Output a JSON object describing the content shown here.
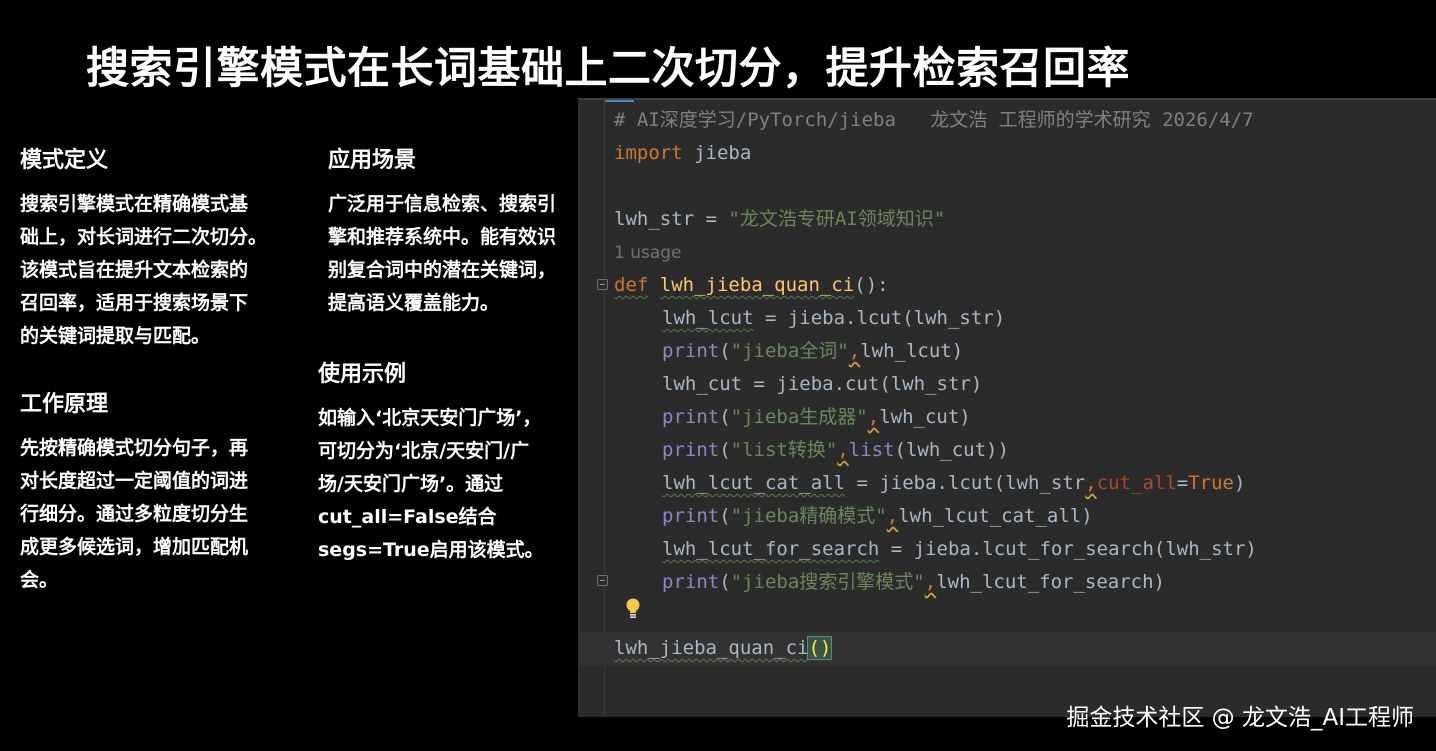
{
  "title": "搜索引擎模式在长词基础上二次切分，提升检索召回率",
  "sections": {
    "definition": {
      "heading": "模式定义",
      "body": "搜索引擎模式在精确模式基\n础上，对长词进行二次切分。\n该模式旨在提升文本检索的\n召回率，适用于搜索场景下\n的关键词提取与匹配。"
    },
    "principle": {
      "heading": "工作原理",
      "body": "先按精确模式切分句子，再\n对长度超过一定阈值的词进\n行细分。通过多粒度切分生\n成更多候选词，增加匹配机\n会。"
    },
    "application": {
      "heading": "应用场景",
      "body": "广泛用于信息检索、搜索引\n擎和推荐系统中。能有效识\n别复合词中的潜在关键词，\n提高语义覆盖能力。"
    },
    "example": {
      "heading": "使用示例",
      "body": "如输入‘北京天安门广场’，\n可切分为‘北京/天安门/广\n场/天安门广场’。通过\ncut_all=False结合\nsegs=True启用该模式。"
    }
  },
  "code": {
    "comment": "# AI深度学习/PyTorch/jieba   龙文浩 工程师的学术研究 2026/4/7",
    "import_kw": "import",
    "import_mod": " jieba",
    "assign_var": "lwh_str",
    "assign_op": " = ",
    "assign_str": "\"龙文浩专研AI领域知识\"",
    "usage_hint": "1 usage",
    "def_kw": "def",
    "def_name": "lwh_jieba_quan_ci",
    "def_tail": "():",
    "l1_var": "lwh_lcut",
    "l1_rest": " = jieba.lcut(lwh_str)",
    "p1_fn": "print",
    "p1_open": "(",
    "p1_str": "\"jieba全词\"",
    "p1_comma": ",",
    "p1_arg": "lwh_lcut)",
    "l2": "lwh_cut = jieba.cut(lwh_str)",
    "p2_fn": "print",
    "p2_open": "(",
    "p2_str": "\"jieba生成器\"",
    "p2_comma": ",",
    "p2_arg": "lwh_cut)",
    "p3_fn": "print",
    "p3_open": "(",
    "p3_str": "\"list转换\"",
    "p3_comma": ",",
    "p3_builtin": "list",
    "p3_arg": "(lwh_cut))",
    "l4_var": "lwh_lcut_cat_all",
    "l4_mid": " = jieba.lcut(lwh_str",
    "l4_comma": ",",
    "l4_param": "cut_all",
    "l4_eq": "=",
    "l4_true": "True",
    "l4_close": ")",
    "p4_fn": "print",
    "p4_open": "(",
    "p4_str": "\"jieba精确模式\"",
    "p4_comma": ",",
    "p4_arg": "lwh_lcut_cat_all)",
    "l5_var": "lwh_lcut_for_search",
    "l5_rest": " = jieba.lcut_for_search(lwh_str)",
    "p5_fn": "print",
    "p5_open": "(",
    "p5_str": "\"jieba搜索引擎模式\"",
    "p5_comma": ",",
    "p5_arg": "lwh_lcut_for_search)",
    "call_name": "lwh_jieba_quan_ci",
    "call_parens": "()"
  },
  "colors": {
    "editor_bg": "#2b2b2b",
    "keyword": "#cc7832",
    "function": "#ffc66d",
    "string": "#6a8759",
    "builtin": "#8888c6",
    "comment": "#808080"
  },
  "watermark": "掘金技术社区 @ 龙文浩_AI工程师"
}
